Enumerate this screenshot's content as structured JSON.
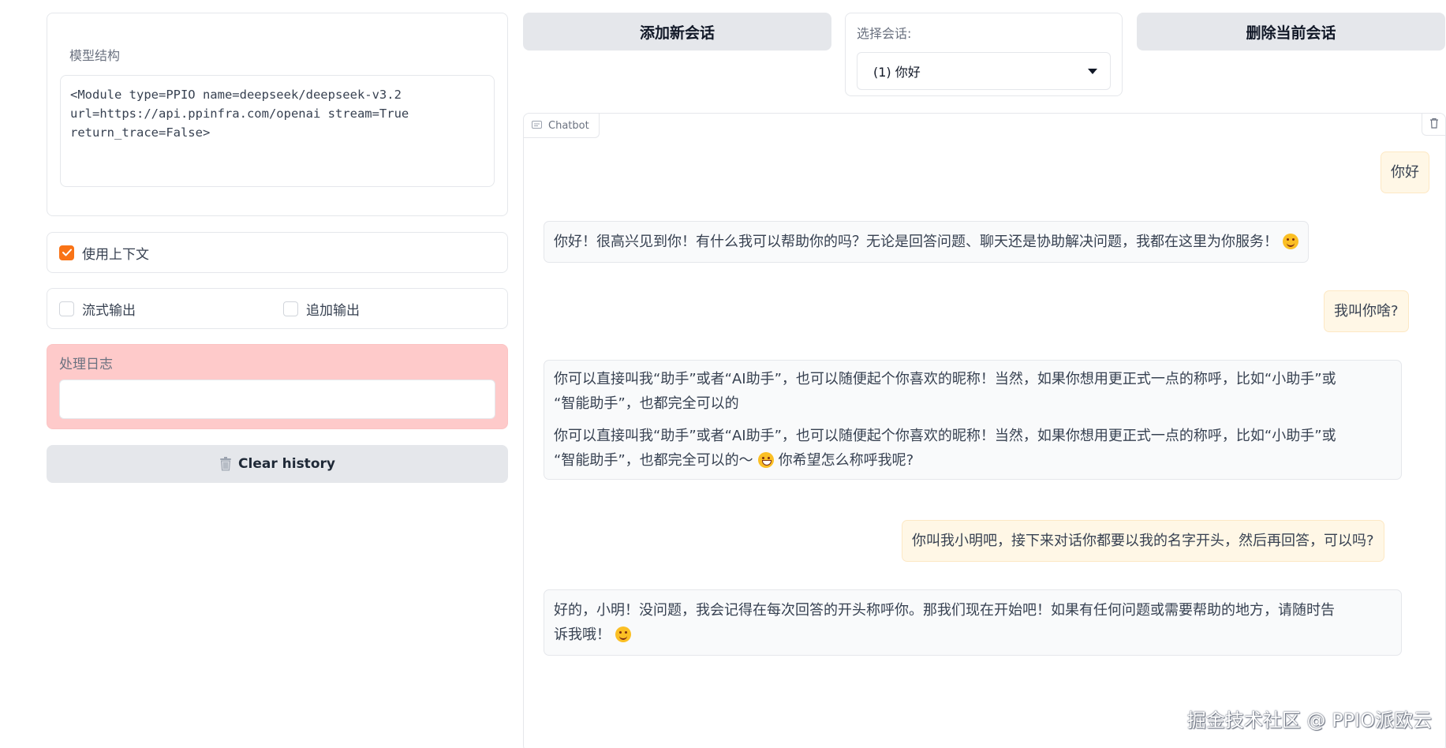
{
  "model_panel": {
    "label": "模型结构",
    "text": "<Module type=PPIO name=deepseek/deepseek-v3.2\nurl=https://api.ppinfra.com/openai stream=True\nreturn_trace=False>"
  },
  "options": {
    "use_context": {
      "label": "使用上下文",
      "checked": true
    },
    "stream_output": {
      "label": "流式输出",
      "checked": false
    },
    "append_output": {
      "label": "追加输出",
      "checked": false
    }
  },
  "log": {
    "label": "处理日志",
    "value": ""
  },
  "clear_history": {
    "label": "Clear history",
    "icon": "trash-icon"
  },
  "toolbar": {
    "add_session_label": "添加新会话",
    "delete_session_label": "删除当前会话"
  },
  "session": {
    "label": "选择会话:",
    "selected": "(1) 你好"
  },
  "chatbot": {
    "tag": "Chatbot",
    "messages": [
      {
        "role": "user",
        "text": "你好"
      },
      {
        "role": "bot",
        "text": "你好！很高兴见到你！有什么我可以帮助你的吗？无论是回答问题、聊天还是协助解决问题，我都在这里为你服务！"
      },
      {
        "role": "user",
        "text": "我叫你啥?"
      },
      {
        "role": "bot",
        "p1_line1": "你可以直接叫我“助手”或者“AI助手”，也可以随便起个你喜欢的昵称！当然，如果你想用更正式一点的称呼，比如“小助手”或",
        "p1_line2": "“智能助手”，也都完全可以的",
        "p2_line1": "你可以直接叫我“助手”或者“AI助手”，也可以随便起个你喜欢的昵称！当然，如果你想用更正式一点的称呼，比如“小助手”或",
        "p2_line2a": "“智能助手”，也都完全可以的～",
        "p2_line2b": "你希望怎么称呼我呢?"
      },
      {
        "role": "user",
        "text": "你叫我小明吧，接下来对话你都要以我的名字开头，然后再回答，可以吗?"
      },
      {
        "role": "bot",
        "line1": "好的，小明！没问题，我会记得在每次回答的开头称呼你。那我们现在开始吧！如果有任何问题或需要帮助的地方，请随时告",
        "line2": "诉我哦！"
      }
    ]
  },
  "watermark": "掘金技术社区 @ PPIO派欧云",
  "colors": {
    "accent": "#f97316",
    "user_bubble": "#fff7e6",
    "bot_bubble": "#f9fafb",
    "log_bg": "#fecaca",
    "button_bg": "#e5e7eb"
  }
}
